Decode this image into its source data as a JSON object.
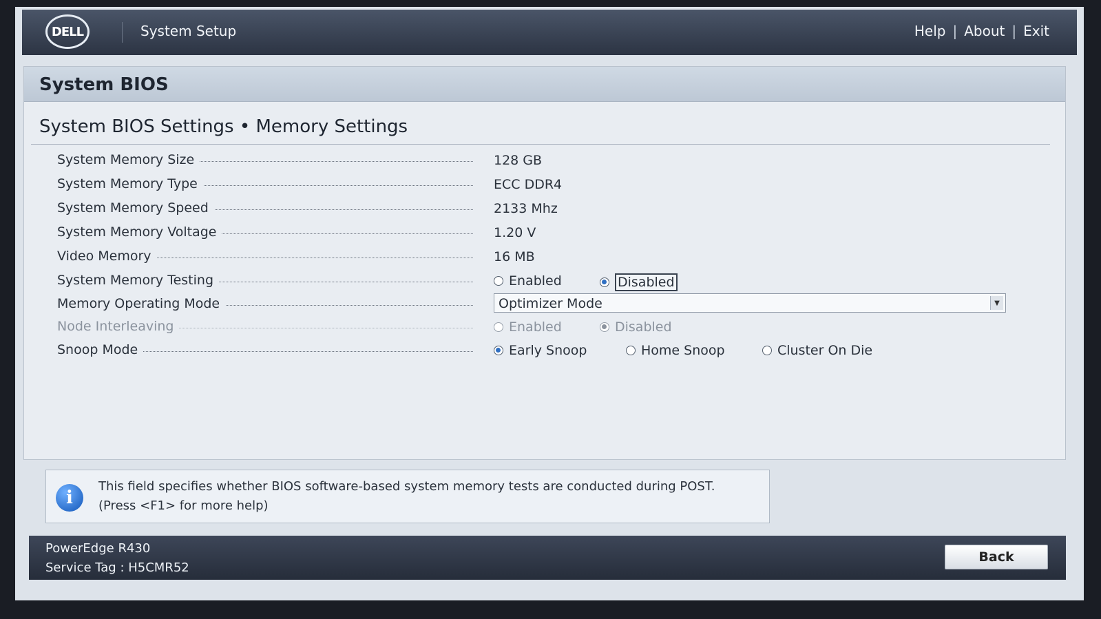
{
  "header": {
    "logo_text": "DELL",
    "app_title": "System Setup",
    "links": {
      "help": "Help",
      "about": "About",
      "exit": "Exit",
      "separator": "|"
    }
  },
  "panel": {
    "title": "System BIOS",
    "section_title": "System BIOS Settings • Memory Settings",
    "rows": [
      {
        "label": "System Memory Size",
        "value": "128 GB"
      },
      {
        "label": "System Memory Type",
        "value": "ECC DDR4"
      },
      {
        "label": "System Memory Speed",
        "value": "2133 Mhz"
      },
      {
        "label": "System Memory Voltage",
        "value": "1.20 V"
      },
      {
        "label": "Video Memory",
        "value": "16 MB"
      }
    ],
    "memory_testing": {
      "label": "System Memory Testing",
      "options": [
        "Enabled",
        "Disabled"
      ],
      "selected": "Disabled"
    },
    "operating_mode": {
      "label": "Memory Operating Mode",
      "value": "Optimizer Mode"
    },
    "node_interleaving": {
      "label": "Node Interleaving",
      "options": [
        "Enabled",
        "Disabled"
      ],
      "selected": "Disabled",
      "disabled": true
    },
    "snoop_mode": {
      "label": "Snoop Mode",
      "options": [
        "Early Snoop",
        "Home Snoop",
        "Cluster On Die"
      ],
      "selected": "Early Snoop"
    }
  },
  "info": {
    "icon": "info-icon",
    "icon_glyph": "i",
    "line1": "This field specifies whether BIOS software-based system memory tests are conducted during POST.",
    "line2": "(Press <F1> for more help)"
  },
  "footer": {
    "model": "PowerEdge R430",
    "service_tag": "Service Tag : H5CMR52",
    "back_label": "Back"
  },
  "colors": {
    "header_bg": "#2c3443",
    "panel_bg": "#e9edf2",
    "radio_selected": "#2f6fc2"
  }
}
